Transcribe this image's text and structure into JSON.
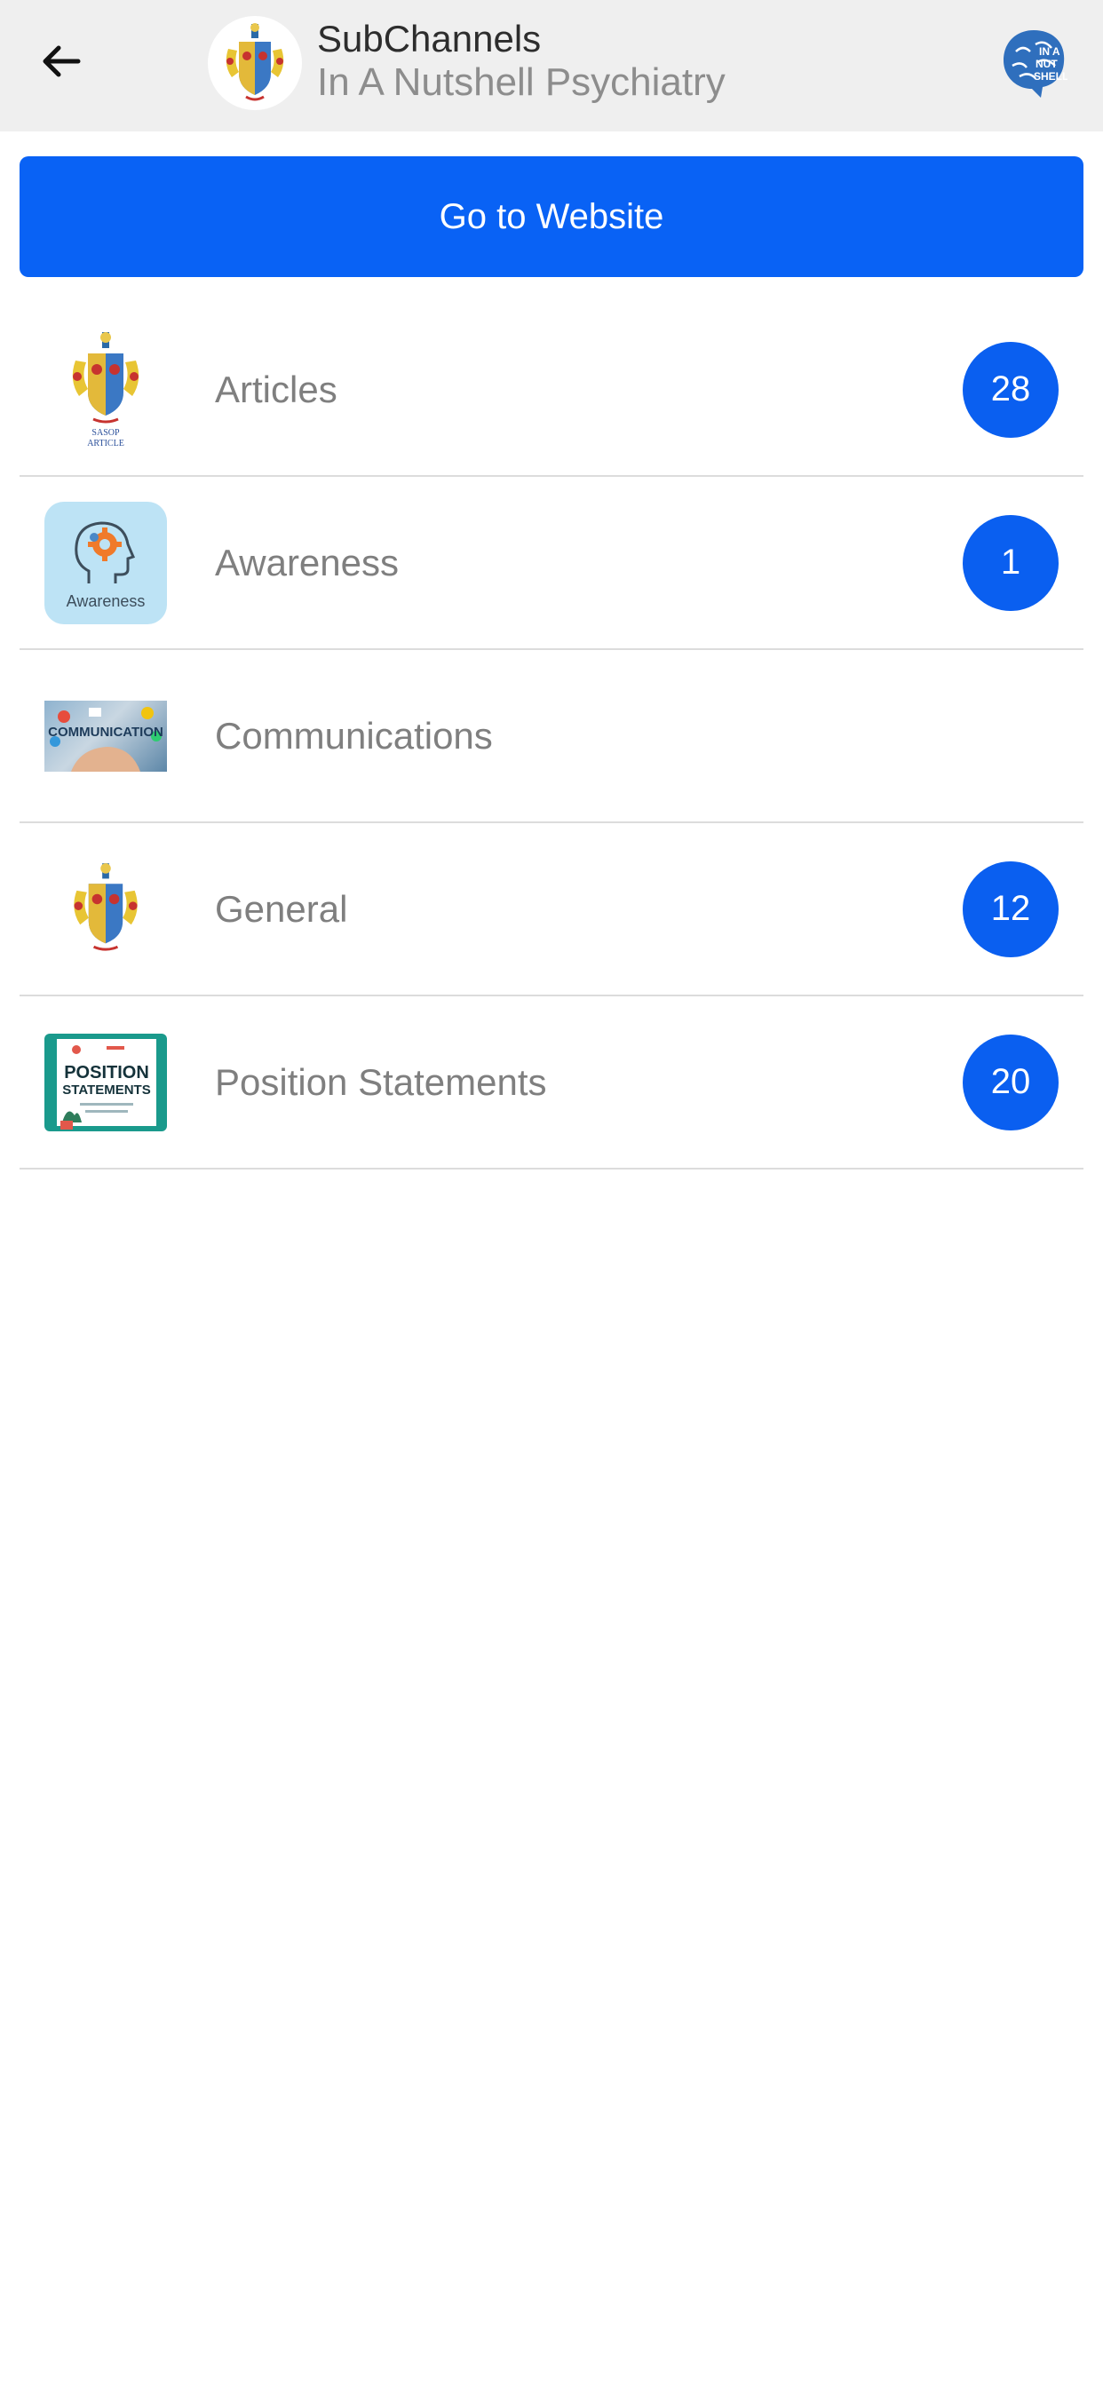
{
  "header": {
    "title": "SubChannels",
    "subtitle": "In A Nutshell Psychiatry",
    "back_icon": "arrow-left-icon",
    "channel_logo": "crest-logo",
    "profile_logo": "in-a-nutshell-brain-logo"
  },
  "website_button": {
    "label": "Go to Website"
  },
  "subchannels": [
    {
      "label": "Articles",
      "count": "28",
      "thumb": "crest-article",
      "thumb_caption": "SASOP\nARTICLE"
    },
    {
      "label": "Awareness",
      "count": "1",
      "thumb": "awareness-head",
      "thumb_caption": "Awareness"
    },
    {
      "label": "Communications",
      "count": "",
      "thumb": "communication-photo",
      "thumb_caption": "COMMUNICATION"
    },
    {
      "label": "General",
      "count": "12",
      "thumb": "crest"
    },
    {
      "label": "Position Statements",
      "count": "20",
      "thumb": "position-statements-poster",
      "thumb_caption": "POSITION\nSTATEMENTS"
    }
  ],
  "colors": {
    "accent": "#0962f5",
    "header_bg": "#efefef",
    "label_text": "#7f7f7f",
    "divider": "#dcdcdc"
  }
}
